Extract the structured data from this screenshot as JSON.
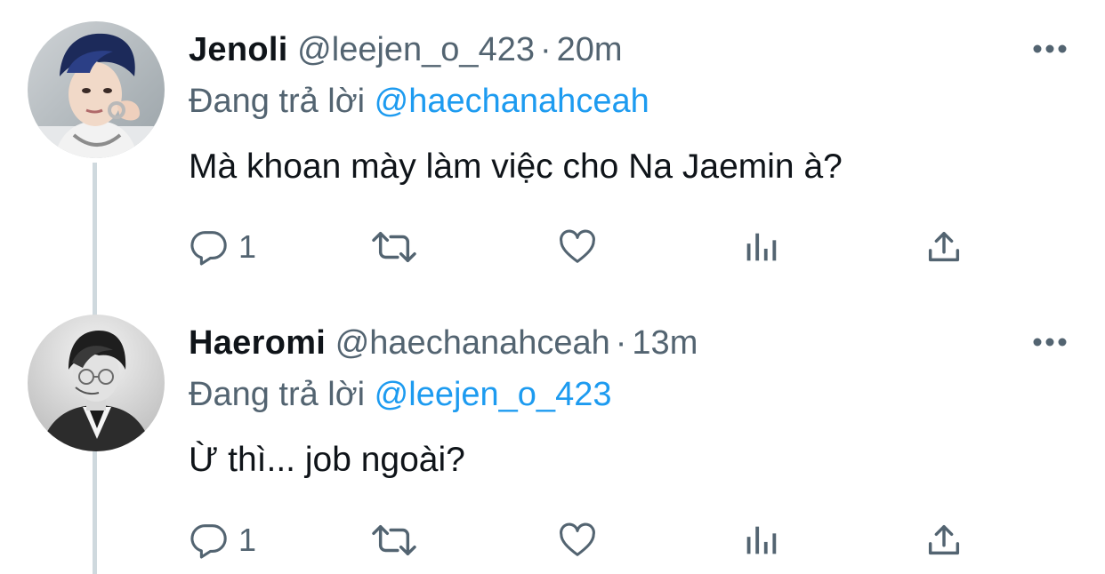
{
  "tweets": [
    {
      "name": "Jenoli",
      "handle": "@leejen_o_423",
      "separator": "·",
      "time": "20m",
      "replying_prefix": "Đang trả lời",
      "replying_to": "@haechanahceah",
      "text": "Mà khoan mày làm việc cho Na Jaemin à?",
      "reply_count": "1",
      "avatar_icon": "avatar-photo"
    },
    {
      "name": "Haeromi",
      "handle": "@haechanahceah",
      "separator": "·",
      "time": "13m",
      "replying_prefix": "Đang trả lời",
      "replying_to": "@leejen_o_423",
      "text": "Ừ thì... job ngoài?",
      "reply_count": "1",
      "avatar_icon": "avatar-photo"
    }
  ],
  "colors": {
    "text": "#0f1419",
    "secondary": "#536471",
    "link": "#1d9bf0",
    "thread_line": "#cfd9de"
  },
  "icons": [
    "more-icon",
    "reply-icon",
    "retweet-icon",
    "like-icon",
    "views-icon",
    "share-icon"
  ]
}
